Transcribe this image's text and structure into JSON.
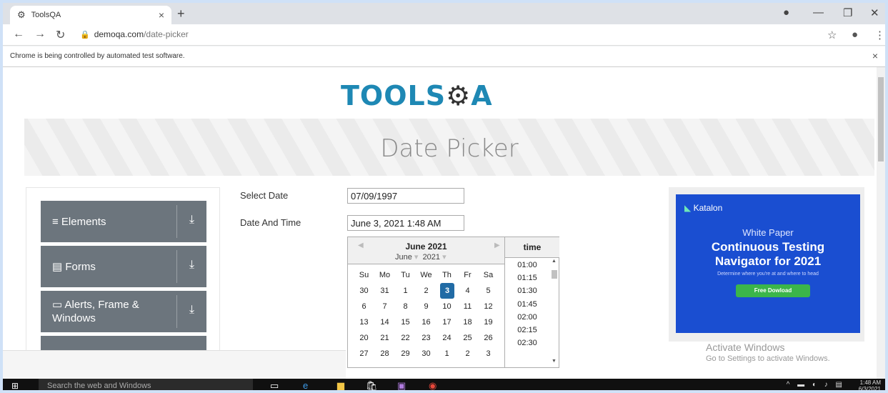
{
  "browser": {
    "tab_title": "ToolsQA",
    "tab_close": "×",
    "new_tab": "+",
    "url_host": "demoqa.com",
    "url_path": "/date-picker",
    "infobar_message": "Chrome is being controlled by automated test software.",
    "infobar_close": "×"
  },
  "page": {
    "logo_text": "TOOLS",
    "logo_suffix": "A",
    "banner_title": "Date Picker"
  },
  "sidebar": {
    "items": [
      {
        "label": "Elements",
        "icon": "hamburger-icon"
      },
      {
        "label": "Forms",
        "icon": "form-icon"
      },
      {
        "label": "Alerts, Frame & Windows",
        "icon": "window-icon"
      }
    ]
  },
  "form": {
    "select_date_label": "Select Date",
    "select_date_value": "07/09/1997",
    "date_time_label": "Date And Time",
    "date_time_value": "June 3, 2021 1:48 AM"
  },
  "datepicker": {
    "month_title": "June 2021",
    "month_select": "June",
    "year_select": "2021",
    "weekdays": [
      "Su",
      "Mo",
      "Tu",
      "We",
      "Th",
      "Fr",
      "Sa"
    ],
    "weeks": [
      [
        "30",
        "31",
        "1",
        "2",
        "3",
        "4",
        "5"
      ],
      [
        "6",
        "7",
        "8",
        "9",
        "10",
        "11",
        "12"
      ],
      [
        "13",
        "14",
        "15",
        "16",
        "17",
        "18",
        "19"
      ],
      [
        "20",
        "21",
        "22",
        "23",
        "24",
        "25",
        "26"
      ],
      [
        "27",
        "28",
        "29",
        "30",
        "1",
        "2",
        "3"
      ]
    ],
    "selected_day": "3",
    "time_header": "time",
    "times": [
      "01:00",
      "01:15",
      "01:30",
      "01:45",
      "02:00",
      "02:15",
      "02:30"
    ]
  },
  "ad": {
    "brand": "Katalon",
    "kicker": "White Paper",
    "title_line1": "Continuous Testing",
    "title_line2": "Navigator for 2021",
    "subtitle": "Determine where you're at and where to head",
    "button": "Free Dowload"
  },
  "watermark": {
    "line1": "Activate Windows",
    "line2": "Go to Settings to activate Windows."
  },
  "taskbar": {
    "search_placeholder": "Search the web and Windows",
    "time": "1:48 AM",
    "date": "6/3/2021"
  },
  "colors": {
    "accent": "#1e88b4",
    "sidebar_group": "#6c757d",
    "selected_day": "#216ba5",
    "ad_bg": "#1a4ed1",
    "ad_button": "#3bb54a"
  }
}
